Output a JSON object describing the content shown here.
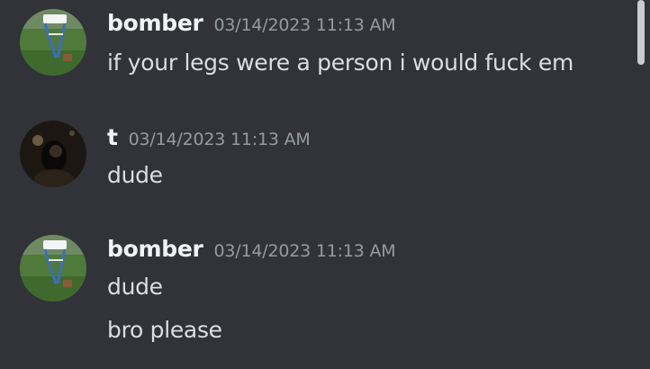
{
  "colors": {
    "background": "#313338",
    "username": "#f2f3f5",
    "timestamp": "#949ba4",
    "message_text": "#dbdee1"
  },
  "messages": [
    {
      "username": "bomber",
      "timestamp": "03/14/2023 11:13 AM",
      "avatar": "grass-field-avatar",
      "lines": [
        "if your legs were a person i would fuck em"
      ]
    },
    {
      "username": "t",
      "timestamp": "03/14/2023 11:13 AM",
      "avatar": "dark-portrait-avatar",
      "lines": [
        "dude"
      ]
    },
    {
      "username": "bomber",
      "timestamp": "03/14/2023 11:13 AM",
      "avatar": "grass-field-avatar",
      "lines": [
        "dude",
        "bro please"
      ]
    }
  ]
}
